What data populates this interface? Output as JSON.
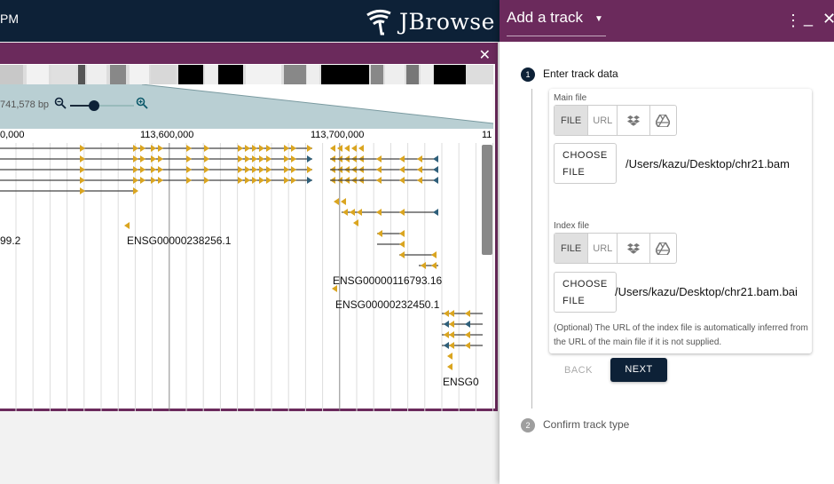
{
  "appbar": {
    "partial_text": "PM",
    "logo_text": "JBrowse"
  },
  "genome_view": {
    "bp_label": "741,578 bp",
    "ruler": [
      "0,000",
      "113,600,000",
      "113,700,000",
      "11"
    ],
    "gene_labels": [
      "99.2",
      "ENSG00000238256.1",
      "ENSG00000116793.16",
      "ENSG00000232450.1",
      "ENSG0"
    ],
    "colors": {
      "header": "#6b2a5c",
      "exon": "#daa520",
      "exon_alt": "#2f5f7a",
      "overview": "#b9cfd3"
    }
  },
  "drawer": {
    "title": "Add a track",
    "step1": {
      "number": "1",
      "label": "Enter track data"
    },
    "step2": {
      "number": "2",
      "label": "Confirm track type"
    },
    "main_file": {
      "label": "Main file",
      "toggle": [
        "FILE",
        "URL"
      ],
      "choose_line1": "CHOOSE",
      "choose_line2": "FILE",
      "path": "/Users/kazu/Desktop/chr21.bam"
    },
    "index_file": {
      "label": "Index file",
      "toggle": [
        "FILE",
        "URL"
      ],
      "choose_line1": "CHOOSE",
      "choose_line2": "FILE",
      "path": "/Users/kazu/Desktop/chr21.bam.bai"
    },
    "helper_text": "(Optional) The URL of the index file is automatically inferred from the URL of the main file if it is not supplied.",
    "back_label": "BACK",
    "next_label": "NEXT"
  }
}
